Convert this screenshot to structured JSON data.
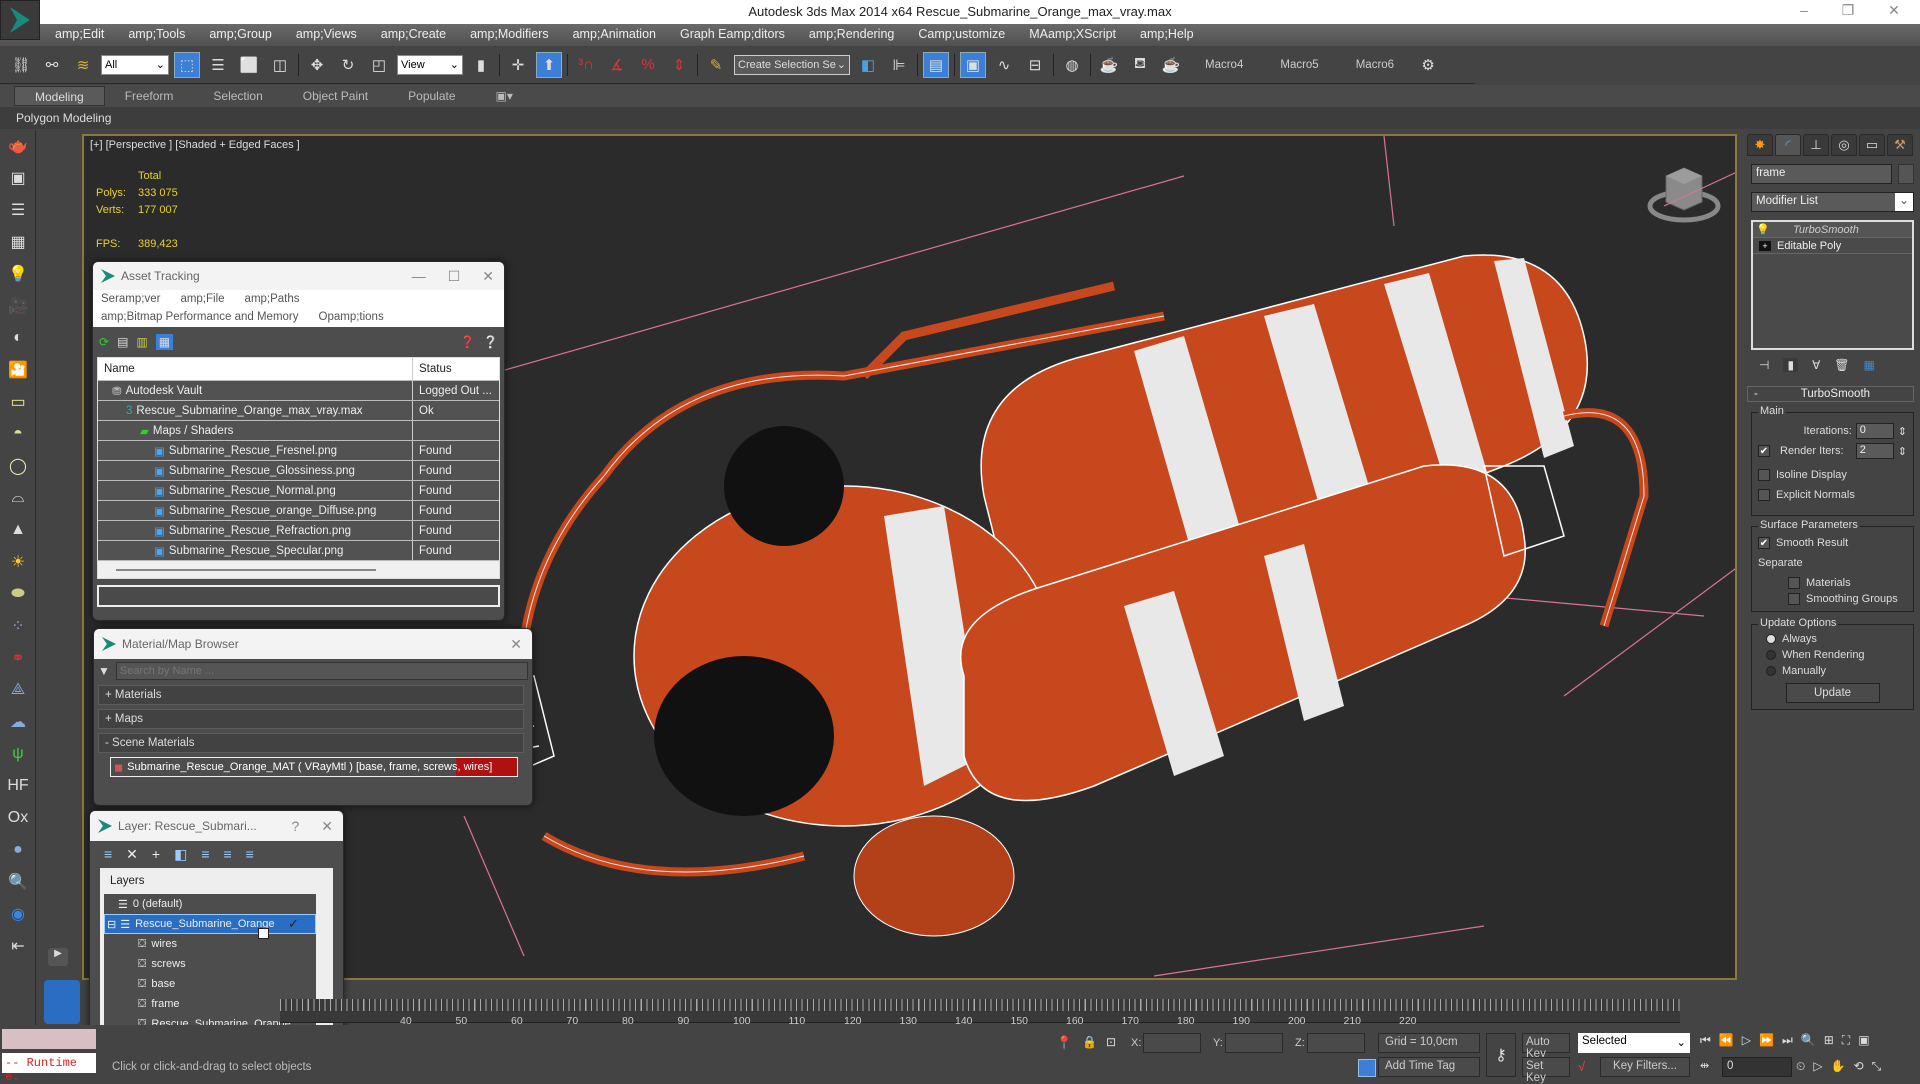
{
  "window": {
    "title": "Autodesk 3ds Max  2014 x64     Rescue_Submarine_Orange_max_vray.max",
    "controls": {
      "minimize": "–",
      "restore": "❐",
      "close": "✕"
    }
  },
  "menubar": [
    "amp;Edit",
    "amp;Tools",
    "amp;Group",
    "amp;Views",
    "amp;Create",
    "amp;Modifiers",
    "amp;Animation",
    "Graph Eamp;ditors",
    "amp;Rendering",
    "Camp;ustomize",
    "MAamp;XScript",
    "amp;Help"
  ],
  "toolbar": {
    "filter_value": "All",
    "ref_coord_value": "View",
    "selection_set_placeholder": "Create Selection Se",
    "macros": [
      "Macro4",
      "Macro5",
      "Macro6"
    ]
  },
  "ribbon": {
    "tabs": [
      "Modeling",
      "Freeform",
      "Selection",
      "Object Paint",
      "Populate"
    ],
    "selected": "Modeling",
    "subpanel": "Polygon Modeling"
  },
  "viewport": {
    "label": "[+] [Perspective ] [Shaded + Edged Faces ]",
    "stats": {
      "header": "Total",
      "polys_label": "Polys:",
      "polys": "333 075",
      "verts_label": "Verts:",
      "verts": "177 007",
      "fps_label": "FPS:",
      "fps": "389,423"
    },
    "colors": {
      "orange": "#c8481e",
      "white": "#e8e8e8",
      "wire": "#ffffff"
    }
  },
  "asset_tracking": {
    "title": "Asset Tracking",
    "menu_row1": [
      "Seramp;ver",
      "amp;File",
      "amp;Paths"
    ],
    "menu_row2": [
      "amp;Bitmap Performance and Memory",
      "Opamp;tions"
    ],
    "columns": {
      "name": "Name",
      "status": "Status"
    },
    "rows": [
      {
        "name": "Autodesk Vault",
        "status": "Logged Out ...",
        "indent": 1,
        "icon": "vault-icon"
      },
      {
        "name": "Rescue_Submarine_Orange_max_vray.max",
        "status": "Ok",
        "indent": 2,
        "icon": "max-file-icon"
      },
      {
        "name": "Maps / Shaders",
        "status": "",
        "indent": 3,
        "icon": "maps-folder-icon"
      },
      {
        "name": "Submarine_Rescue_Fresnel.png",
        "status": "Found",
        "indent": 4,
        "icon": "image-file-icon"
      },
      {
        "name": "Submarine_Rescue_Glossiness.png",
        "status": "Found",
        "indent": 4,
        "icon": "image-file-icon"
      },
      {
        "name": "Submarine_Rescue_Normal.png",
        "status": "Found",
        "indent": 4,
        "icon": "image-file-icon"
      },
      {
        "name": "Submarine_Rescue_orange_Diffuse.png",
        "status": "Found",
        "indent": 4,
        "icon": "image-file-icon"
      },
      {
        "name": "Submarine_Rescue_Refraction.png",
        "status": "Found",
        "indent": 4,
        "icon": "image-file-icon"
      },
      {
        "name": "Submarine_Rescue_Specular.png",
        "status": "Found",
        "indent": 4,
        "icon": "image-file-icon"
      }
    ]
  },
  "material_browser": {
    "title": "Material/Map Browser",
    "search_placeholder": "Search by Name ...",
    "sections": [
      "+ Materials",
      "+ Maps",
      "- Scene Materials"
    ],
    "scene_material": "Submarine_Rescue_Orange_MAT  ( VRayMtl )  [base, frame, screws, wires]"
  },
  "layer_dialog": {
    "title": "Layer: Rescue_Submari...",
    "help": "?",
    "header": "Layers",
    "layers": [
      {
        "name": "0 (default)",
        "level": 0,
        "selected": false,
        "icon": "layer-icon"
      },
      {
        "name": "Rescue_Submarine_Orange",
        "level": 0,
        "selected": true,
        "icon": "layer-icon"
      },
      {
        "name": "wires",
        "level": 1,
        "selected": false,
        "icon": "object-icon"
      },
      {
        "name": "screws",
        "level": 1,
        "selected": false,
        "icon": "object-icon"
      },
      {
        "name": "base",
        "level": 1,
        "selected": false,
        "icon": "object-icon"
      },
      {
        "name": "frame",
        "level": 1,
        "selected": false,
        "icon": "object-icon"
      },
      {
        "name": "Rescue_Submarine_Orange",
        "level": 1,
        "selected": false,
        "icon": "object-icon"
      }
    ]
  },
  "command_panel": {
    "object_name": "frame",
    "modifier_list": "Modifier List",
    "stack": [
      "TurboSmooth",
      "Editable Poly"
    ],
    "rollout_title": "TurboSmooth",
    "main": {
      "title": "Main",
      "iterations_label": "Iterations:",
      "iterations": "0",
      "render_iters_label": "Render Iters:",
      "render_iters": "2",
      "render_iters_checked": true,
      "isoline_label": "Isoline Display",
      "isoline_checked": false,
      "explicit_label": "Explicit Normals",
      "explicit_checked": false
    },
    "surface": {
      "title": "Surface Parameters",
      "smooth_label": "Smooth Result",
      "smooth_checked": true,
      "separate_label": "Separate",
      "materials_label": "Materials",
      "materials_checked": false,
      "smoothing_label": "Smoothing Groups",
      "smoothing_checked": false
    },
    "update": {
      "title": "Update Options",
      "options": [
        "Always",
        "When Rendering",
        "Manually"
      ],
      "selected": "Always",
      "button": "Update"
    }
  },
  "timeline": {
    "ticks": [
      "40",
      "50",
      "60",
      "70",
      "80",
      "90",
      "100",
      "110",
      "120",
      "130",
      "140",
      "150",
      "160",
      "170",
      "180",
      "190",
      "200",
      "210",
      "220"
    ]
  },
  "statusbar": {
    "script_listener": "-- Runtime e.",
    "prompt": "Click or click-and-drag to select objects",
    "x_label": "X:",
    "y_label": "Y:",
    "z_label": "Z:",
    "grid": "Grid = 10,0cm",
    "add_time_tag": "Add Time Tag",
    "auto_key": "Auto Key",
    "set_key": "Set Key",
    "selected_value": "Selected",
    "key_filters": "Key Filters...",
    "frame_value": "0"
  }
}
